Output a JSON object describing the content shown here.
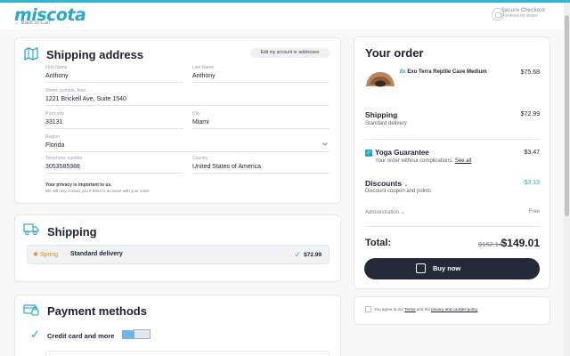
{
  "header": {
    "logo": "miscota",
    "back_link": "← Back to Cart",
    "secure_title": "Secure Checkout",
    "secure_powered": "Powered by stripe"
  },
  "shipping_address": {
    "title": "Shipping address",
    "edit_button": "Edit my account or addresses",
    "fields": {
      "first_name": {
        "label": "First Name",
        "value": "Anthony"
      },
      "last_name": {
        "label": "Last Name",
        "value": "Anthony"
      },
      "street": {
        "label": "Street, number, floor...",
        "value": "1221 Brickell Ave, Suite 1540"
      },
      "postcode": {
        "label": "Postcode",
        "value": "33131"
      },
      "city": {
        "label": "City",
        "value": "Miami"
      },
      "region": {
        "label": "Region",
        "value": "Florida"
      },
      "phone": {
        "label": "Telephone number",
        "value": "3053585988"
      },
      "country": {
        "label": "Country",
        "value": "United States of America"
      }
    },
    "privacy_title": "Your privacy is important to us.",
    "privacy_text": "We will only contact you if there is an issue with your order."
  },
  "shipping": {
    "title": "Shipping",
    "carrier": "Spring",
    "method": "Standard delivery",
    "price": "$72.99"
  },
  "payment": {
    "title": "Payment methods",
    "method": "Credit card and more"
  },
  "order": {
    "title": "Your order",
    "product": {
      "qty": "8x",
      "name": "Exo Terra Reptile Cave Medium",
      "price": "$75.68"
    },
    "shipping": {
      "title": "Shipping",
      "sub": "Standard delivery",
      "price": "$72.99"
    },
    "yoga": {
      "title": "Yoga Guarantee",
      "sub": "Your order without complications.",
      "link": "See all",
      "price": "$3.47"
    },
    "discounts": {
      "title": "Discounts",
      "sub": "Discount coupon and points",
      "price": "-$3.13"
    },
    "administration": {
      "label": "Administration",
      "price": "Free"
    },
    "total": {
      "label": "Total:",
      "old": "$152.14",
      "new": "$149.01"
    },
    "buy_button": "Buy now"
  },
  "agree": {
    "prefix": "You agree to our",
    "terms": "Terms",
    "middle": "and the",
    "privacy": "privacy and cookies policy"
  },
  "colors": {
    "accent": "#2aa7c9",
    "button": "#252a39"
  }
}
